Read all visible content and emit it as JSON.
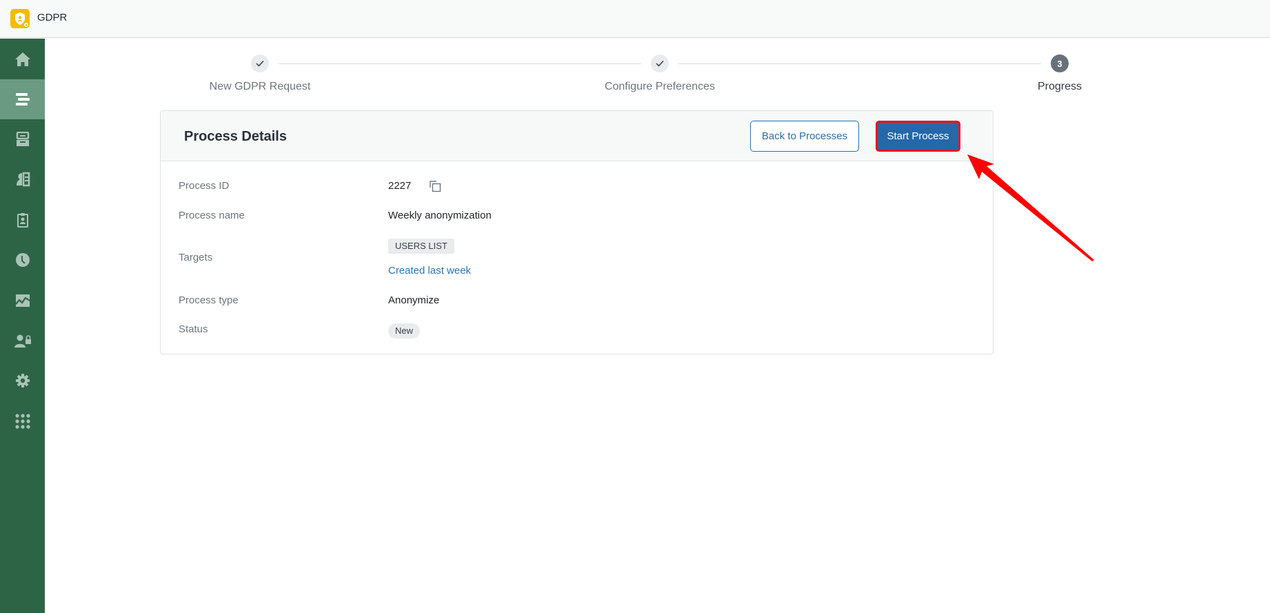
{
  "app": {
    "title": "GDPR",
    "logo_icon": "shield-user-icon",
    "brand_color": "#f5bb00"
  },
  "sidebar": {
    "color": "#2e6446",
    "active_color": "#6b9a82",
    "items": [
      {
        "name": "home",
        "icon": "home-icon",
        "active": false
      },
      {
        "name": "processes",
        "icon": "list-icon",
        "active": true
      },
      {
        "name": "archive",
        "icon": "archive-icon",
        "active": false
      },
      {
        "name": "requests",
        "icon": "user-document-icon",
        "active": false
      },
      {
        "name": "consents",
        "icon": "clipboard-user-icon",
        "active": false
      },
      {
        "name": "history",
        "icon": "clock-icon",
        "active": false
      },
      {
        "name": "reports",
        "icon": "chart-icon",
        "active": false
      },
      {
        "name": "access",
        "icon": "user-lock-icon",
        "active": false
      },
      {
        "name": "settings",
        "icon": "gear-icon",
        "active": false
      },
      {
        "name": "apps",
        "icon": "grid-icon",
        "active": false
      }
    ]
  },
  "stepper": {
    "steps": [
      {
        "label": "New GDPR Request",
        "state": "done",
        "marker": "✓"
      },
      {
        "label": "Configure Preferences",
        "state": "done",
        "marker": "✓"
      },
      {
        "label": "Progress",
        "state": "current",
        "marker": "3"
      }
    ]
  },
  "card": {
    "title": "Process Details",
    "back_label": "Back to Processes",
    "start_label": "Start Process",
    "primary_color": "#2468aa",
    "rows": {
      "process_id": {
        "label": "Process ID",
        "value": "2227"
      },
      "process_name": {
        "label": "Process name",
        "value": "Weekly anonymization"
      },
      "targets": {
        "label": "Targets",
        "tag": "USERS LIST",
        "link": "Created last week"
      },
      "process_type": {
        "label": "Process type",
        "value": "Anonymize"
      },
      "status": {
        "label": "Status",
        "value": "New"
      }
    }
  },
  "annotation": {
    "type": "arrow",
    "color": "#ff0000",
    "points_to": "start-process-button"
  }
}
